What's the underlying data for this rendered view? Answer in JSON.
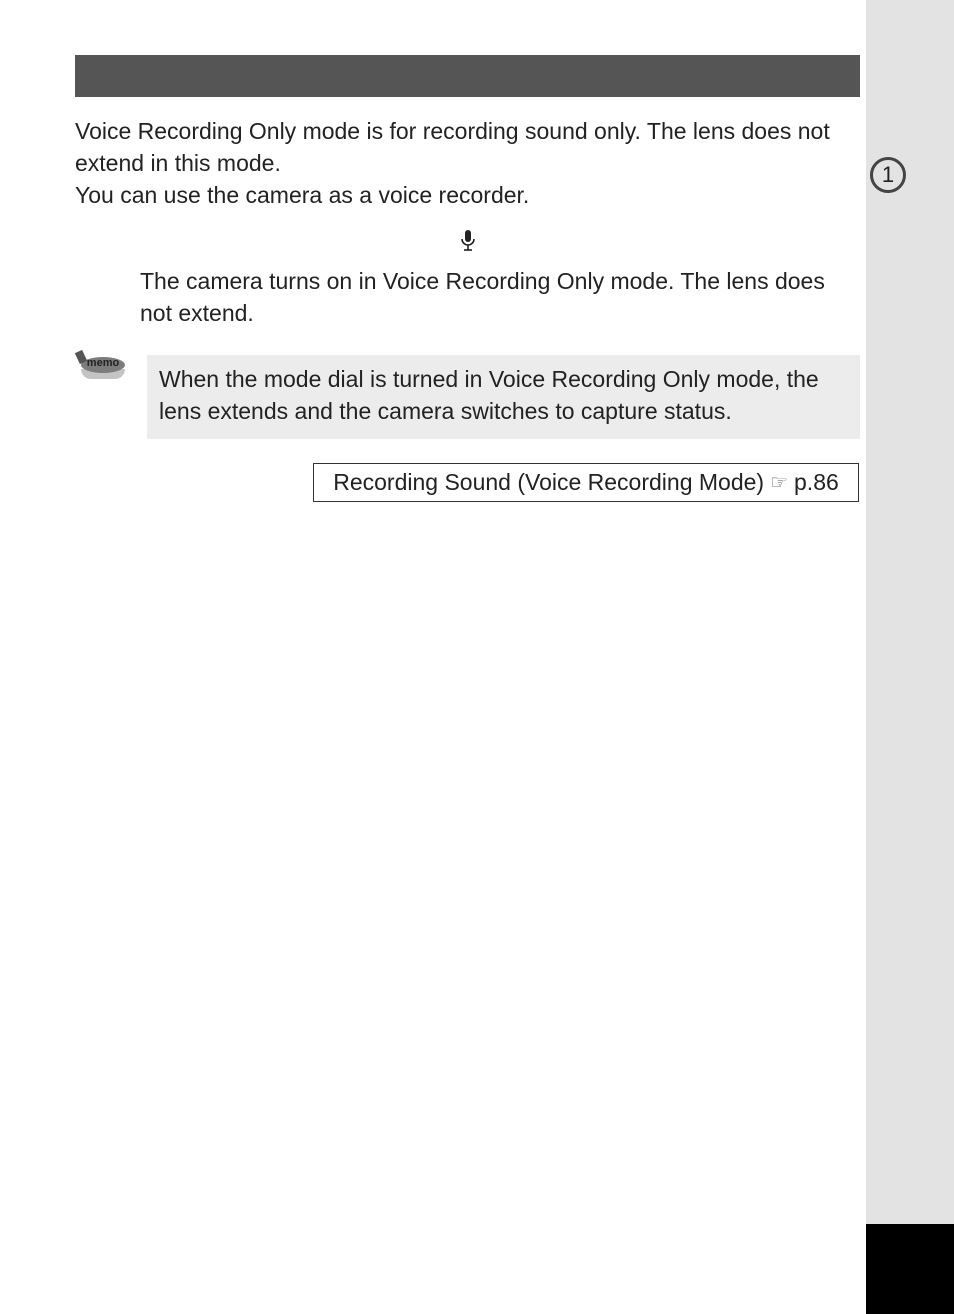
{
  "sidebar": {
    "chapter": "1"
  },
  "intro": {
    "line1": "Voice Recording Only mode is for recording sound only. The lens does not extend in this mode.",
    "line2": "You can use the camera as a voice recorder."
  },
  "step": {
    "text": "The camera turns on in Voice Recording Only mode. The lens does not extend."
  },
  "memo": {
    "label": "memo",
    "text": "When the mode dial is turned in Voice Recording Only mode, the lens extends and the camera switches to capture status."
  },
  "reference": {
    "text": "Recording Sound (Voice Recording Mode)",
    "pointer": "☞",
    "page": "p.86"
  }
}
